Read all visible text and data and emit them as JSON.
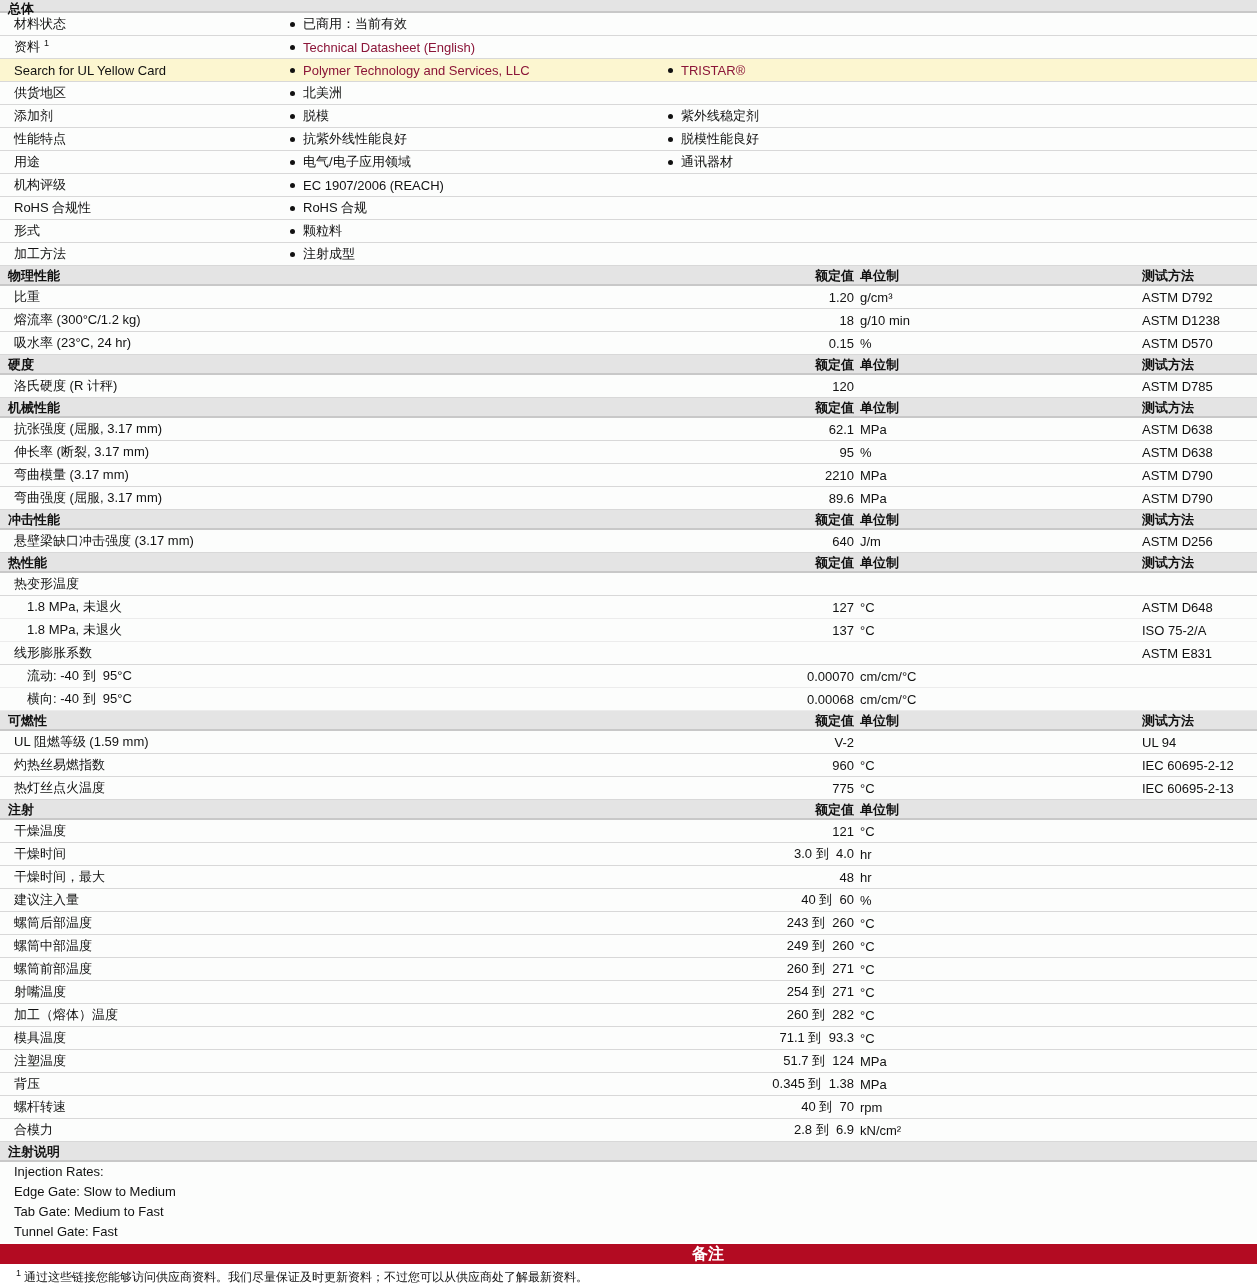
{
  "general": {
    "title": "总体",
    "rows": [
      {
        "label": "材料状态",
        "highlighted": false,
        "items": [
          {
            "text": "已商用：当前有效",
            "link": false
          }
        ]
      },
      {
        "label": "资料",
        "note": "1",
        "highlighted": false,
        "items": [
          {
            "text": "Technical Datasheet (English)",
            "link": true
          }
        ]
      },
      {
        "label": "Search for UL Yellow Card",
        "highlighted": true,
        "items": [
          {
            "text": "Polymer Technology and Services, LLC",
            "link": true
          },
          {
            "text": "TRISTAR®",
            "link": true
          }
        ]
      },
      {
        "label": "供货地区",
        "highlighted": false,
        "items": [
          {
            "text": "北美洲",
            "link": false
          }
        ]
      },
      {
        "label": "添加剂",
        "highlighted": false,
        "items": [
          {
            "text": "脱模",
            "link": false
          },
          {
            "text": "紫外线稳定剂",
            "link": false
          }
        ]
      },
      {
        "label": "性能特点",
        "highlighted": false,
        "items": [
          {
            "text": "抗紫外线性能良好",
            "link": false
          },
          {
            "text": "脱模性能良好",
            "link": false
          }
        ]
      },
      {
        "label": "用途",
        "highlighted": false,
        "items": [
          {
            "text": "电气/电子应用领域",
            "link": false
          },
          {
            "text": "通讯器材",
            "link": false
          }
        ]
      },
      {
        "label": "机构评级",
        "highlighted": false,
        "items": [
          {
            "text": "EC 1907/2006 (REACH)",
            "link": false
          }
        ]
      },
      {
        "label": "RoHS 合规性",
        "highlighted": false,
        "items": [
          {
            "text": "RoHS 合规",
            "link": false
          }
        ]
      },
      {
        "label": "形式",
        "highlighted": false,
        "items": [
          {
            "text": "颗粒料",
            "link": false
          }
        ]
      },
      {
        "label": "加工方法",
        "highlighted": false,
        "items": [
          {
            "text": "注射成型",
            "link": false
          }
        ]
      }
    ]
  },
  "sections": [
    {
      "title": "物理性能",
      "value_header": "额定值",
      "unit_header": "单位制",
      "method_header": "测试方法",
      "rows": [
        {
          "kind": "row",
          "label": "比重",
          "value": "1.20",
          "unit": "g/cm³",
          "method": "ASTM D792"
        },
        {
          "kind": "row",
          "label": "熔流率 (300°C/1.2 kg)",
          "value": "18",
          "unit": "g/10 min",
          "method": "ASTM D1238"
        },
        {
          "kind": "row",
          "label": "吸水率 (23°C, 24 hr)",
          "value": "0.15",
          "unit": "%",
          "method": "ASTM D570"
        }
      ]
    },
    {
      "title": "硬度",
      "value_header": "额定值",
      "unit_header": "单位制",
      "method_header": "测试方法",
      "rows": [
        {
          "kind": "row",
          "label": "洛氏硬度 (R 计秤)",
          "value": "120",
          "method": "ASTM D785"
        }
      ]
    },
    {
      "title": "机械性能",
      "value_header": "额定值",
      "unit_header": "单位制",
      "method_header": "测试方法",
      "rows": [
        {
          "kind": "row",
          "label": "抗张强度 (屈服, 3.17 mm)",
          "value": "62.1",
          "unit": "MPa",
          "method": "ASTM D638"
        },
        {
          "kind": "row",
          "label": "伸长率 (断裂, 3.17 mm)",
          "value": "95",
          "unit": "%",
          "method": "ASTM D638"
        },
        {
          "kind": "row",
          "label": "弯曲模量 (3.17 mm)",
          "value": "2210",
          "unit": "MPa",
          "method": "ASTM D790"
        },
        {
          "kind": "row",
          "label": "弯曲强度 (屈服, 3.17 mm)",
          "value": "89.6",
          "unit": "MPa",
          "method": "ASTM D790"
        }
      ]
    },
    {
      "title": "冲击性能",
      "value_header": "额定值",
      "unit_header": "单位制",
      "method_header": "测试方法",
      "rows": [
        {
          "kind": "row",
          "label": "悬壁梁缺口冲击强度 (3.17 mm)",
          "value": "640",
          "unit": "J/m",
          "method": "ASTM D256"
        }
      ]
    },
    {
      "title": "热性能",
      "value_header": "额定值",
      "unit_header": "单位制",
      "method_header": "测试方法",
      "rows": [
        {
          "kind": "row",
          "label": "热变形温度"
        },
        {
          "kind": "sub",
          "label": "1.8 MPa, 未退火",
          "value": "127",
          "unit": "°C",
          "method": "ASTM D648"
        },
        {
          "kind": "sub",
          "label": "1.8 MPa, 未退火",
          "value": "137",
          "unit": "°C",
          "method": "ISO 75-2/A"
        },
        {
          "kind": "row",
          "label": "线形膨胀系数",
          "method": "ASTM E831"
        },
        {
          "kind": "sub",
          "label": "流动: -40 到  95°C",
          "value": "0.00070",
          "unit": "cm/cm/°C"
        },
        {
          "kind": "sub",
          "label": "横向: -40 到  95°C",
          "value": "0.00068",
          "unit": "cm/cm/°C"
        }
      ]
    },
    {
      "title": "可燃性",
      "value_header": "额定值",
      "unit_header": "单位制",
      "method_header": "测试方法",
      "rows": [
        {
          "kind": "row",
          "label": "UL 阻燃等级 (1.59 mm)",
          "value": "V-2",
          "method": "UL 94"
        },
        {
          "kind": "row",
          "label": "灼热丝易燃指数",
          "value": "960",
          "unit": "°C",
          "method": "IEC 60695-2-12"
        },
        {
          "kind": "row",
          "label": "热灯丝点火温度",
          "value": "775",
          "unit": "°C",
          "method": "IEC 60695-2-13"
        }
      ]
    },
    {
      "title": "注射",
      "value_header": "额定值",
      "unit_header": "单位制",
      "rows": [
        {
          "kind": "row",
          "label": "干燥温度",
          "value": "121",
          "unit": "°C"
        },
        {
          "kind": "row",
          "label": "干燥时间",
          "value": "3.0 到  4.0",
          "unit": "hr"
        },
        {
          "kind": "row",
          "label": "干燥时间，最大",
          "value": "48",
          "unit": "hr"
        },
        {
          "kind": "row",
          "label": "建议注入量",
          "value": "40 到  60",
          "unit": "%"
        },
        {
          "kind": "row",
          "label": "螺筒后部温度",
          "value": "243 到  260",
          "unit": "°C"
        },
        {
          "kind": "row",
          "label": "螺筒中部温度",
          "value": "249 到  260",
          "unit": "°C"
        },
        {
          "kind": "row",
          "label": "螺筒前部温度",
          "value": "260 到  271",
          "unit": "°C"
        },
        {
          "kind": "row",
          "label": "射嘴温度",
          "value": "254 到  271",
          "unit": "°C"
        },
        {
          "kind": "row",
          "label": "加工（熔体）温度",
          "value": "260 到  282",
          "unit": "°C"
        },
        {
          "kind": "row",
          "label": "模具温度",
          "value": "71.1 到  93.3",
          "unit": "°C"
        },
        {
          "kind": "row",
          "label": "注塑温度",
          "value": "51.7 到  124",
          "unit": "MPa"
        },
        {
          "kind": "row",
          "label": "背压",
          "value": "0.345 到  1.38",
          "unit": "MPa"
        },
        {
          "kind": "row",
          "label": "螺杆转速",
          "value": "40 到  70",
          "unit": "rpm"
        },
        {
          "kind": "row",
          "label": "合模力",
          "value": "2.8 到  6.9",
          "unit": "kN/cm²"
        }
      ]
    }
  ],
  "notes": {
    "title": "注射说明",
    "lines": [
      "Injection Rates:",
      "Edge Gate: Slow to Medium",
      "Tab Gate: Medium to Fast",
      "Tunnel Gate: Fast"
    ]
  },
  "remarks": {
    "title": "备注",
    "footnotes": [
      {
        "mark": "1",
        "text": "通过这些链接您能够访问供应商资料。我们尽量保证及时更新资料；不过您可以从供应商处了解最新资料。"
      }
    ]
  }
}
